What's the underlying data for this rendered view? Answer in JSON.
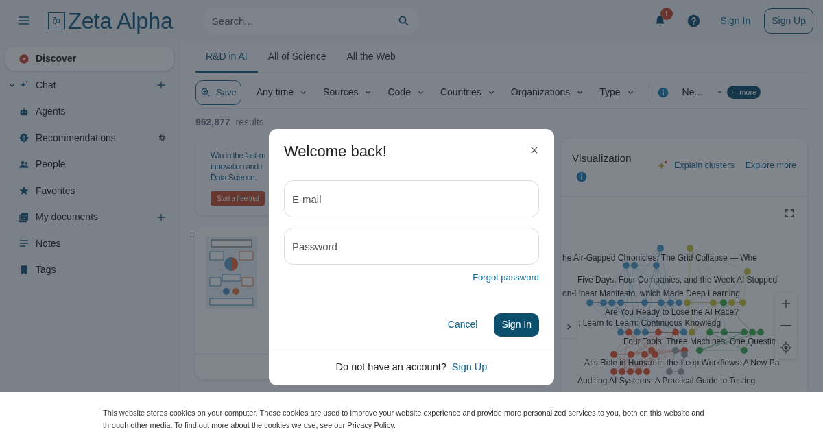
{
  "header": {
    "logo_mark": "ζα",
    "logo": "Zeta Alpha",
    "search": {
      "placeholder": "Search..."
    },
    "notification_count": "1",
    "sign_in": "Sign In",
    "sign_up": "Sign Up"
  },
  "sidebar": {
    "items": [
      {
        "label": "Discover",
        "selected": true
      },
      {
        "label": "Chat",
        "selected": false,
        "expanded": true
      },
      {
        "label": "Agents",
        "selected": false
      },
      {
        "label": "Recommendations",
        "selected": false
      },
      {
        "label": "People",
        "selected": false
      },
      {
        "label": "Favorites",
        "selected": false
      },
      {
        "label": "My documents",
        "selected": false
      },
      {
        "label": "Notes",
        "selected": false
      },
      {
        "label": "Tags",
        "selected": false
      }
    ]
  },
  "tabs": [
    {
      "label": "R&D in AI",
      "selected": true
    },
    {
      "label": "All of Science",
      "selected": false
    },
    {
      "label": "All the Web",
      "selected": false
    }
  ],
  "filters": {
    "save": "Save",
    "dropdowns": [
      {
        "label": "Any time"
      },
      {
        "label": "Sources"
      },
      {
        "label": "Code"
      },
      {
        "label": "Countries"
      },
      {
        "label": "Organizations"
      },
      {
        "label": "Type"
      }
    ],
    "sort": "Ne...",
    "more": "more"
  },
  "results": {
    "count": "962,877",
    "label": "results"
  },
  "promo": {
    "lines": [
      "Win in the fast-m",
      "innovation and r",
      "Data Science."
    ],
    "button": "Start a free trial"
  },
  "visualization": {
    "title": "Visualization",
    "actions": [
      "Explain clusters",
      "Explore more"
    ],
    "labels": [
      "he Air-Gapped Chronicles: The Grid Collapse — Whe",
      "Five Days, Four Companies, and the Week AI Stopped",
      "on-Linear Manifesto, which Made Deep Learning",
      "Are You Ready to Lose the AI Race?",
      "; Learn to Learn: Continuous Knowledg",
      "Four Tools, Three Machines, One Questio",
      "AI’s Role in Human-in-the-Loop Workflows: A New Pa",
      "Auditing AI Systems: A Practical Guide to Testing"
    ]
  },
  "modal": {
    "title": "Welcome back!",
    "email": {
      "placeholder": "E-mail"
    },
    "password": {
      "placeholder": "Password"
    },
    "forgot": "Forgot password",
    "cancel": "Cancel",
    "submit": "Sign In",
    "footer_text": "Do not have an account?",
    "footer_link": "Sign Up"
  },
  "cookie_banner": {
    "text": "This website stores cookies on your computer. These cookies are used to improve your website experience and provide more personalized services to you, both on this website and through other media. To find out more about the cookies we use, see our Privacy Policy."
  }
}
